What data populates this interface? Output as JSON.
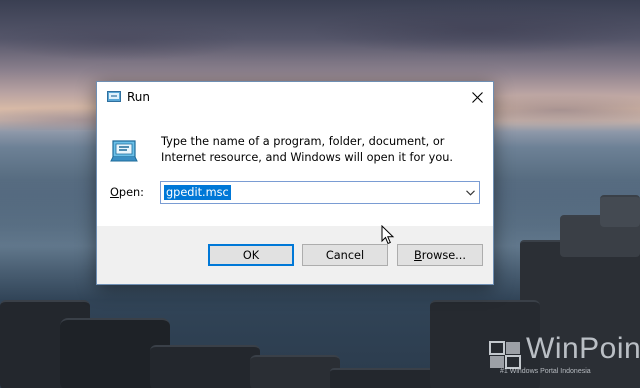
{
  "dialog": {
    "title": "Run",
    "description": "Type the name of a program, folder, document, or Internet resource, and Windows will open it for you.",
    "open_label_prefix": "",
    "open_label_access": "O",
    "open_label_rest": "pen:",
    "input_value": "gpedit.msc",
    "buttons": {
      "ok": "OK",
      "cancel": "Cancel",
      "browse_access": "B",
      "browse_rest": "rowse..."
    }
  },
  "watermark": {
    "brand": "WinPoin",
    "tagline": "#1 Windows Portal Indonesia"
  },
  "icons": {
    "close": "close-icon",
    "run": "run-icon",
    "dropdown": "chevron-down-icon",
    "cursor": "mouse-pointer-icon"
  },
  "colors": {
    "selection": "#0078d7",
    "footer": "#f0f0f0",
    "border": "#6f8fb3"
  }
}
